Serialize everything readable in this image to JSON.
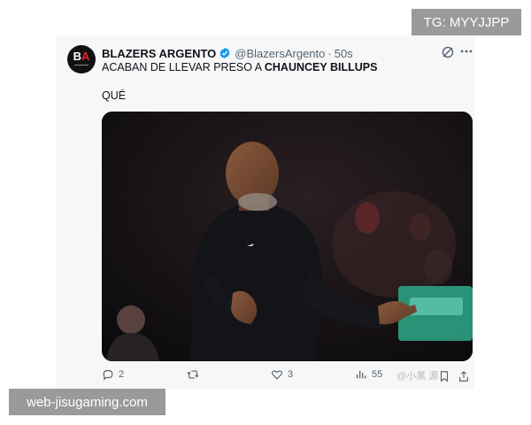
{
  "tweet": {
    "author": {
      "name": "BLAZERS ARGENTO",
      "handle": "@BlazersArgento",
      "time": "50s",
      "separator": "·",
      "avatar_letters": "BA",
      "verified_icon": "verified-badge-icon"
    },
    "text_prefix": "ACABAN DE LLEVAR PRESO A ",
    "text_bold": "CHAUNCEY BILLUPS",
    "text_line2": "QUÉ",
    "media_alt": "photo",
    "actions": {
      "reply_count": "2",
      "retweet_count": "",
      "like_count": "3",
      "view_count": "55"
    },
    "colors": {
      "verified": "#1d9bf0",
      "secondary_text": "#536471",
      "card_bg": "#f7f7f8"
    }
  },
  "overlays": {
    "tg_banner": "TG: MYYJJPP",
    "site_banner": "web-jisugaming.com",
    "source_watermark": "@小黑 源"
  }
}
